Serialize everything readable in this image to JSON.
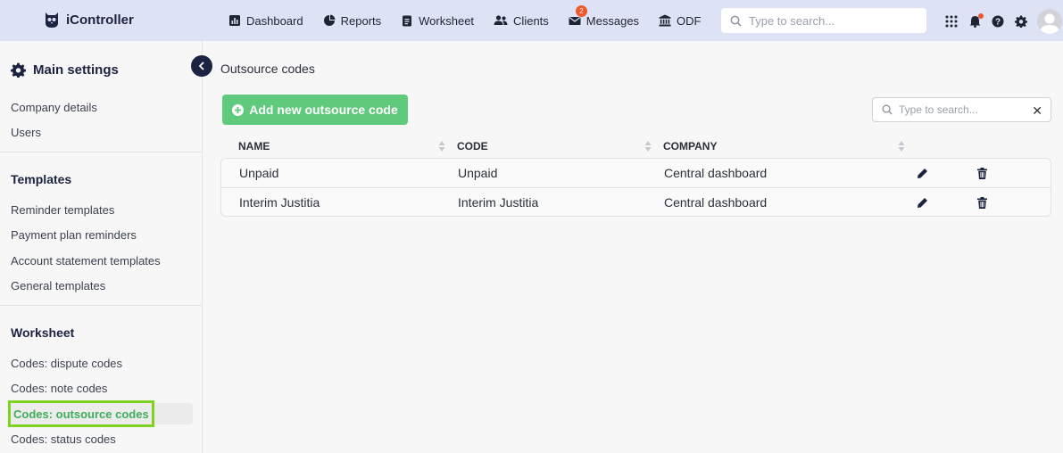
{
  "app": {
    "name": "iController"
  },
  "nav": [
    {
      "label": "Dashboard",
      "icon": "chart-icon"
    },
    {
      "label": "Reports",
      "icon": "pie-icon"
    },
    {
      "label": "Worksheet",
      "icon": "clipboard-icon"
    },
    {
      "label": "Clients",
      "icon": "users-icon"
    },
    {
      "label": "Messages",
      "icon": "mail-icon",
      "badge": "2"
    },
    {
      "label": "ODF",
      "icon": "bank-icon"
    }
  ],
  "search": {
    "placeholder": "Type to search..."
  },
  "sidebar": {
    "header": "Main settings",
    "sections": [
      {
        "title": "",
        "items": [
          "Company details",
          "Users"
        ]
      },
      {
        "title": "Templates",
        "items": [
          "Reminder templates",
          "Payment plan reminders",
          "Account statement templates",
          "General templates"
        ]
      },
      {
        "title": "Worksheet",
        "items": [
          "Codes: dispute codes",
          "Codes: note codes",
          "Codes: outsource codes",
          "Codes: status codes"
        ]
      }
    ],
    "active_item": "Codes: outsource codes"
  },
  "main": {
    "title": "Outsource codes",
    "add_button": "Add new outsource code",
    "table_search_placeholder": "Type to search...",
    "columns": [
      "NAME",
      "CODE",
      "COMPANY"
    ],
    "rows": [
      {
        "name": "Unpaid",
        "code": "Unpaid",
        "company": "Central dashboard"
      },
      {
        "name": "Interim Justitia",
        "code": "Interim Justitia",
        "company": "Central dashboard"
      }
    ]
  },
  "colors": {
    "accent": "#5fca7b",
    "topbar": "#dde3f5",
    "highlight": "#7ed321",
    "navy": "#1c2340",
    "badge": "#f0562c"
  }
}
